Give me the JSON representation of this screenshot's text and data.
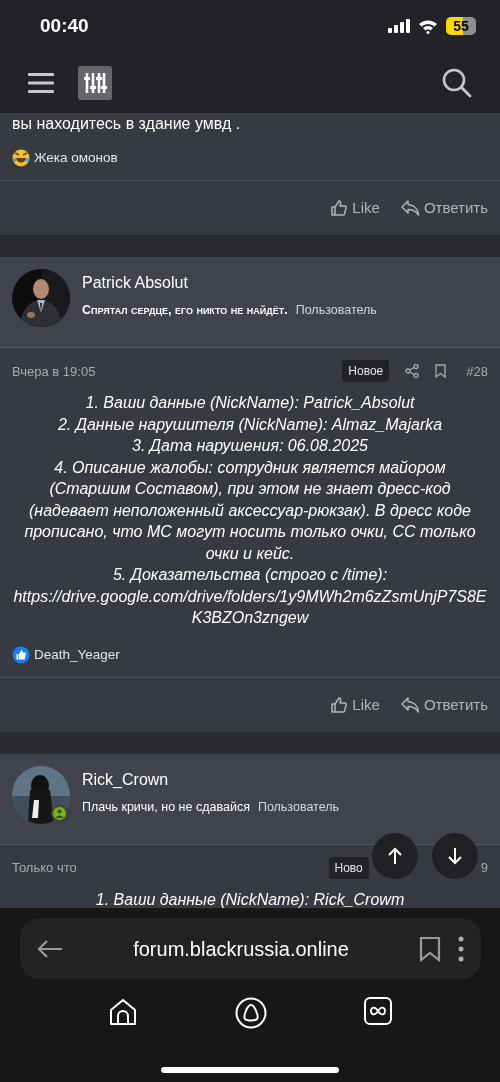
{
  "status_bar": {
    "time": "00:40",
    "battery": "55"
  },
  "posts": [
    {
      "kind": "tail",
      "body": [
        "вы находитесь в здание умвд ."
      ],
      "reaction": {
        "kind": "laugh",
        "user": "Жека омонов"
      },
      "actions": [
        "Like",
        "Ответить"
      ]
    },
    {
      "kind": "full",
      "author": "Patrick Absolut",
      "signature": "Спрятал сердце, его никто не найдёт.",
      "role": "Пользователь",
      "online": false,
      "signature_bold": true,
      "time": "Вчера в 19:05",
      "badge": "Новое",
      "number": "#28",
      "body": [
        "1. Ваши данные (NickName): Patrick_Absolut",
        "2. Данные нарушителя (NickName): Almaz_Majarka",
        "3. Дата нарушения: 06.08.2025",
        "4. Описание жалобы: сотрудник является майором (Старшим Составом), при этом не знает дресс-код (надевает неположенный аксессуар-рюкзак). В дресс коде прописано, что МС могут носить только очки, СС только очки и кейс.",
        "5. Доказательства (строго с /time):",
        "https://drive.google.com/drive/folders/1y9MWh2m6zZsmUnjP7S8EK3BZOn3zngew"
      ],
      "reaction": {
        "kind": "like",
        "user": "Death_Yeager"
      },
      "actions": [
        "Like",
        "Ответить"
      ]
    },
    {
      "kind": "full",
      "author": "Rick_Crown",
      "signature": "Плачь кричи, но не сдавайся",
      "role": "Пользователь",
      "online": true,
      "signature_bold": false,
      "time": "Только что",
      "badge": "Ново",
      "number": "9",
      "body": [
        "1. Ваши данные (NickName): Rick_Crowm"
      ]
    }
  ],
  "browser": {
    "url": "forum.blackrussia.online"
  }
}
